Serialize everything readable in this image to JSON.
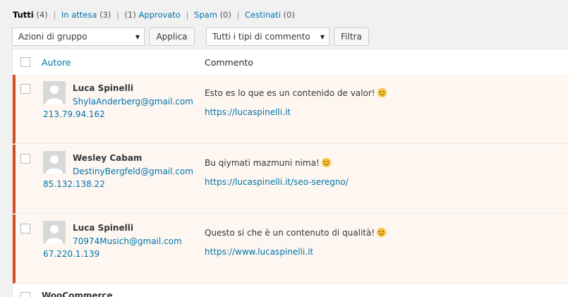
{
  "filters": {
    "all_label": "Tutti",
    "all_count": "(4)",
    "pending_label": "In attesa",
    "pending_count": "(3)",
    "approved_count": "(1)",
    "approved_label": "Approvato",
    "spam_label": "Spam",
    "spam_count": "(0)",
    "trash_label": "Cestinati",
    "trash_count": "(0)",
    "separator": "|"
  },
  "toolbar": {
    "bulk_actions_value": "Azioni di gruppo",
    "apply_label": "Applica",
    "comment_type_value": "Tutti i tipi di commento",
    "filter_label": "Filtra"
  },
  "table": {
    "columns": {
      "author": "Autore",
      "comment": "Commento"
    },
    "rows": [
      {
        "author_name": "Luca Spinelli",
        "author_email": "ShylaAnderberg@gmail.com",
        "author_ip": "213.79.94.162",
        "comment_text": "Esto es lo que es un contenido de valor!",
        "comment_url": "https://lucaspinelli.it"
      },
      {
        "author_name": "Wesley Cabam",
        "author_email": "DestinyBergfeld@gmail.com",
        "author_ip": "85.132.138.22",
        "comment_text": "Bu qiymati mazmuni nima!",
        "comment_url": "https://lucaspinelli.it/seo-seregno/"
      },
      {
        "author_name": "Luca Spinelli",
        "author_email": "70974Musich@gmail.com",
        "author_ip": "67.220.1.139",
        "comment_text": "Questo si che è un contenuto di qualità!",
        "comment_url": "https://www.lucaspinelli.it"
      }
    ],
    "partial_row_text": "WooCommerce"
  },
  "colors": {
    "link": "#0073aa",
    "pending_border": "#d54e21",
    "pending_bg": "#fef7f1"
  }
}
